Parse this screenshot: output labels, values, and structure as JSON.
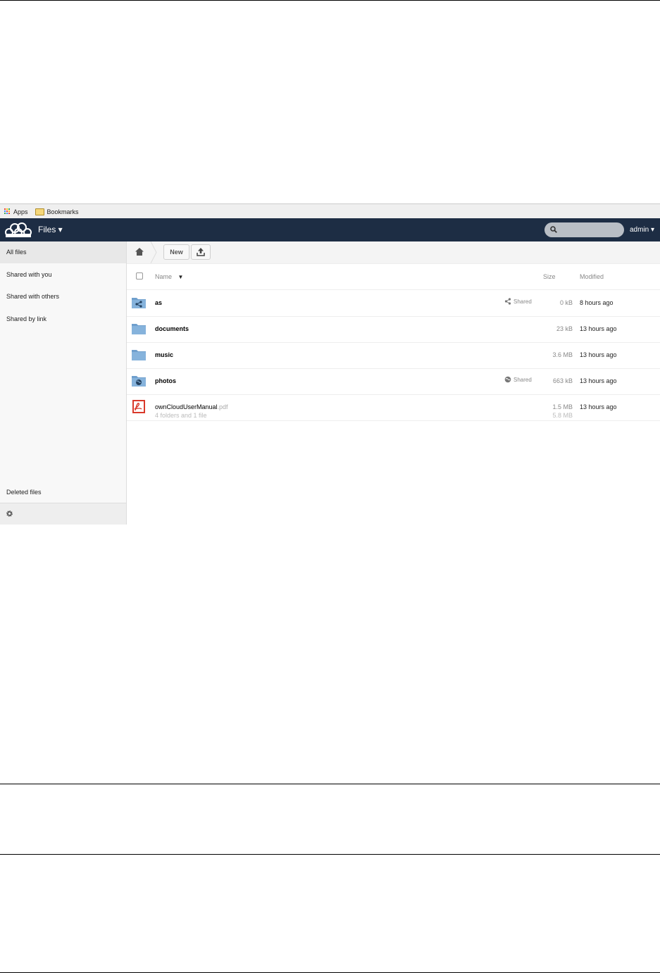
{
  "bookmarks_bar": {
    "apps_label": "Apps",
    "bookmarks_label": "Bookmarks"
  },
  "header": {
    "app_name": "Files ▾",
    "user": "admin ▾",
    "search_placeholder": ""
  },
  "sidebar": {
    "items": [
      {
        "label": "All files"
      },
      {
        "label": "Shared with you"
      },
      {
        "label": "Shared with others"
      },
      {
        "label": "Shared by link"
      }
    ],
    "deleted": "Deleted files"
  },
  "toolbar": {
    "new_label": "New"
  },
  "table": {
    "col_name": "Name",
    "sort_indicator": "▼",
    "col_size": "Size",
    "col_modified": "Modified",
    "rows": [
      {
        "name": "as",
        "icon": "shared-folder-icon",
        "share": "Shared",
        "size": "0 kB",
        "modified": "8 hours ago"
      },
      {
        "name": "documents",
        "icon": "folder-icon",
        "share": "",
        "size": "23 kB",
        "modified": "13 hours ago"
      },
      {
        "name": "music",
        "icon": "folder-icon",
        "share": "",
        "size": "3.6 MB",
        "modified": "13 hours ago"
      },
      {
        "name": "photos",
        "icon": "link-folder-icon",
        "share": "Shared",
        "size": "663 kB",
        "modified": "13 hours ago"
      },
      {
        "name_base": "ownCloudUserManual",
        "name_ext": ".pdf",
        "icon": "pdf-icon",
        "share": "",
        "size": "1.5 MB",
        "modified": "13 hours ago"
      }
    ],
    "summary": "4 folders and 1 file",
    "summary_size": "5.8 MB"
  },
  "colors": {
    "header_bg": "#1d2d44",
    "folder_blue": "#7aa9d4"
  }
}
